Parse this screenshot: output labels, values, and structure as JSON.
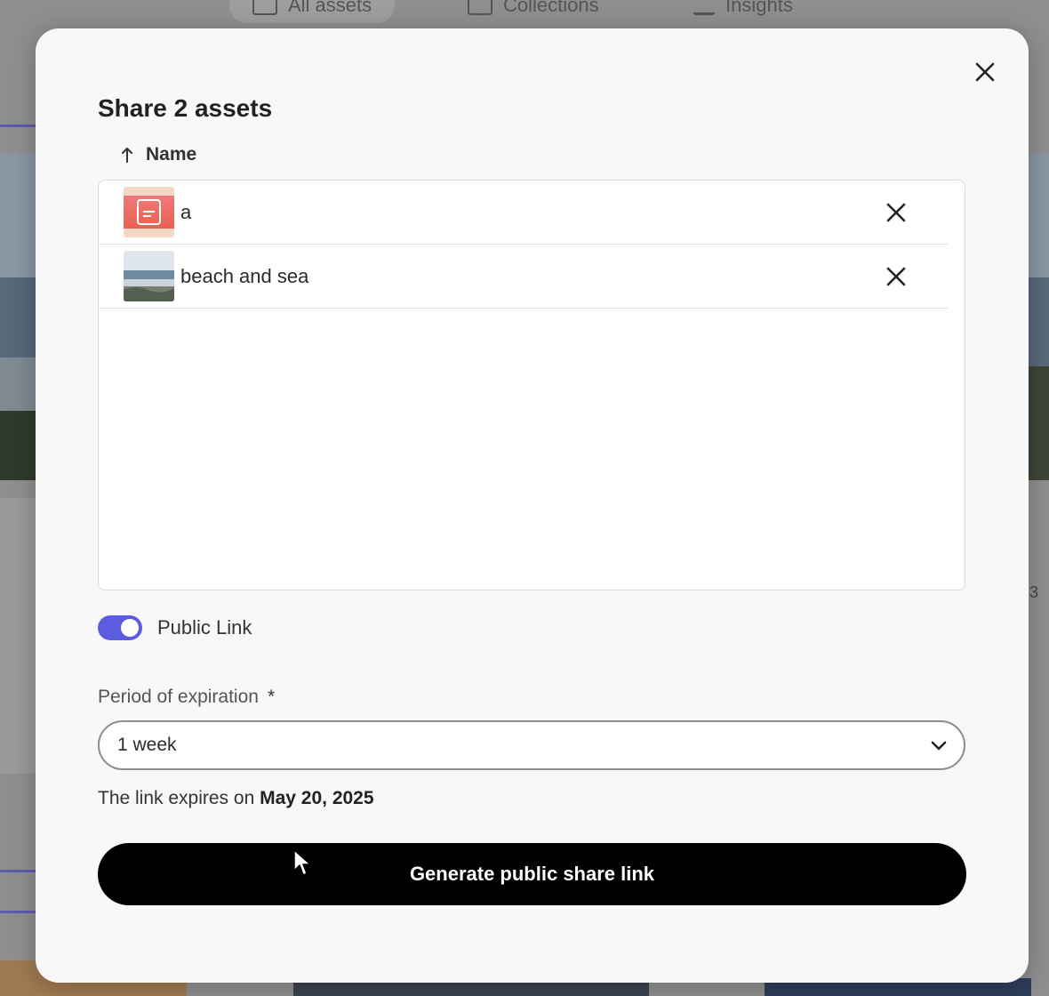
{
  "background": {
    "tabs": [
      {
        "label": "All assets",
        "icon": "assets-icon"
      },
      {
        "label": "Collections",
        "icon": "collections-icon"
      },
      {
        "label": "Insights",
        "icon": "insights-icon"
      }
    ],
    "right_peek_text": "3"
  },
  "dialog": {
    "title": "Share 2 assets",
    "close_icon": "close-icon",
    "sort": {
      "icon": "arrow-up-icon",
      "label": "Name"
    },
    "assets": [
      {
        "name": "a",
        "thumbnail": "pdf-thumbnail"
      },
      {
        "name": "beach and sea",
        "thumbnail": "beach-photo-thumbnail"
      }
    ],
    "public_link": {
      "label": "Public Link",
      "enabled": true,
      "accent": "#5c5ce0"
    },
    "expiration": {
      "label": "Period of expiration",
      "required_marker": "*",
      "selected": "1 week"
    },
    "expiry_note": {
      "prefix": "The link expires on",
      "date": "May 20, 2025"
    },
    "primary_button": "Generate public share link"
  }
}
